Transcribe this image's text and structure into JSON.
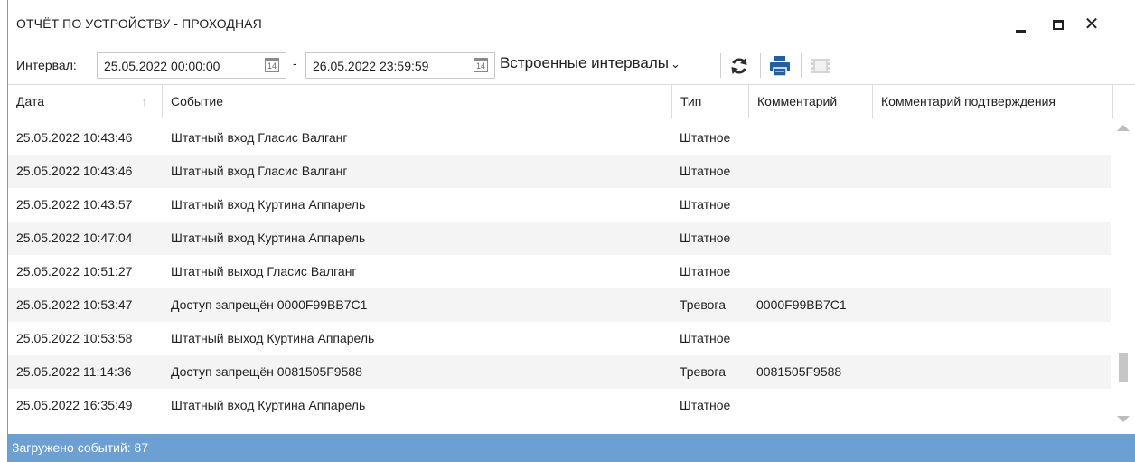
{
  "window": {
    "title": "ОТЧЁТ ПО УСТРОЙСТВУ - ПРОХОДНАЯ",
    "close_glyph": "✕"
  },
  "toolbar": {
    "interval_label": "Интервал:",
    "date_from": "25.05.2022 00:00:00",
    "date_to": "26.05.2022 23:59:59",
    "calendar_day": "14",
    "dash": "-",
    "builtin_intervals": "Встроенные интервалы",
    "chevron": "⌄"
  },
  "grid": {
    "columns": [
      "Дата",
      "Событие",
      "Тип",
      "Комментарий",
      "Комментарий подтверждения"
    ],
    "sort_indicator": "↑",
    "rows": [
      {
        "date": "25.05.2022 10:43:46",
        "event": "Штатный вход Гласис Валганг",
        "type": "Штатное",
        "comment": ""
      },
      {
        "date": "25.05.2022 10:43:46",
        "event": "Штатный вход Гласис Валганг",
        "type": "Штатное",
        "comment": ""
      },
      {
        "date": "25.05.2022 10:43:57",
        "event": "Штатный вход Куртина Аппарель",
        "type": "Штатное",
        "comment": ""
      },
      {
        "date": "25.05.2022 10:47:04",
        "event": "Штатный вход Куртина Аппарель",
        "type": "Штатное",
        "comment": ""
      },
      {
        "date": "25.05.2022 10:51:27",
        "event": "Штатный выход Гласис Валганг",
        "type": "Штатное",
        "comment": ""
      },
      {
        "date": "25.05.2022 10:53:47",
        "event": "Доступ запрещён 0000F99BB7C1",
        "type": "Тревога",
        "comment": "0000F99BB7C1"
      },
      {
        "date": "25.05.2022 10:53:58",
        "event": "Штатный выход Куртина Аппарель",
        "type": "Штатное",
        "comment": ""
      },
      {
        "date": "25.05.2022 11:14:36",
        "event": "Доступ запрещён 0081505F9588",
        "type": "Тревога",
        "comment": "0081505F9588"
      },
      {
        "date": "25.05.2022 16:35:49",
        "event": "Штатный вход Куртина Аппарель",
        "type": "Штатное",
        "comment": ""
      }
    ]
  },
  "status": {
    "text": "Загружено событий: 87"
  },
  "colors": {
    "status_bar": "#6c9fd2",
    "refresh_icon": "#2d2d2d",
    "print_icon": "#1f5fa8"
  }
}
